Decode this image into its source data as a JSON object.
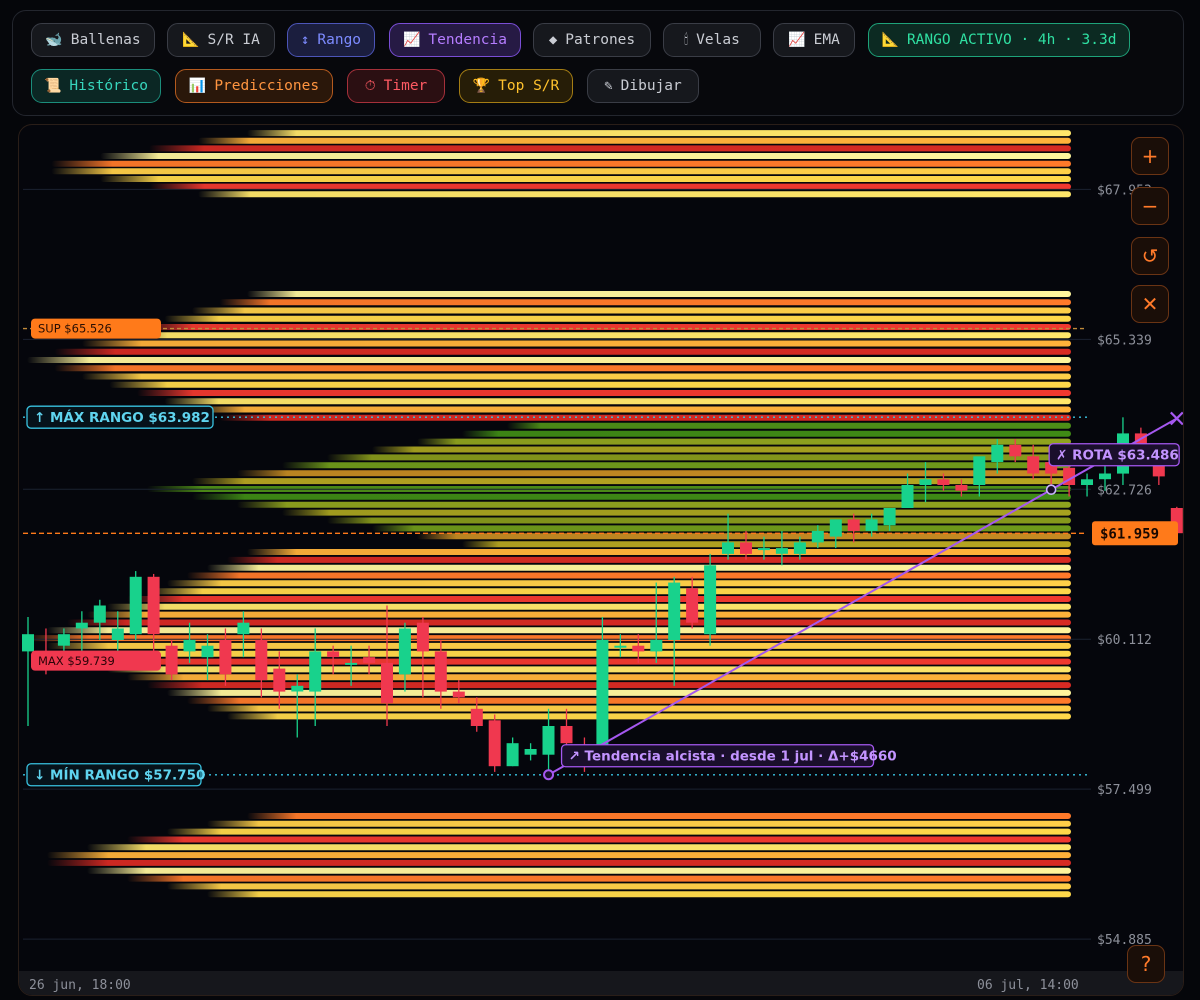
{
  "toolbar": {
    "row1": [
      {
        "name": "ballenas-button",
        "icon_name": "whale-icon",
        "icon": "🐋",
        "label": "Ballenas",
        "style": ""
      },
      {
        "name": "sr-ia-button",
        "icon_name": "triangle-ruler-icon",
        "icon": "📐",
        "label": "S/R IA",
        "style": ""
      },
      {
        "name": "rango-button",
        "icon_name": "up-down-arrow-icon",
        "icon": "↕",
        "label": "Rango",
        "style": "blue"
      },
      {
        "name": "tendencia-button",
        "icon_name": "trend-chart-icon",
        "icon": "📈",
        "label": "Tendencia",
        "style": "purple"
      },
      {
        "name": "patrones-button",
        "icon_name": "diamond-icon",
        "icon": "◆",
        "label": "Patrones",
        "style": ""
      },
      {
        "name": "velas-button",
        "icon_name": "candle-icon",
        "icon": "🕯",
        "label": "Velas",
        "style": ""
      },
      {
        "name": "ema-button",
        "icon_name": "trend-chart-icon",
        "icon": "📈",
        "label": "EMA",
        "style": ""
      },
      {
        "name": "rango-activo-button",
        "icon_name": "triangle-ruler-icon",
        "icon": "📐",
        "label": "RANGO ACTIVO · 4h · 3.3d",
        "style": "green"
      }
    ],
    "row2": [
      {
        "name": "historico-button",
        "icon_name": "scroll-icon",
        "icon": "📜",
        "label": "Histórico",
        "style": "teal"
      },
      {
        "name": "predicciones-button",
        "icon_name": "bar-chart-icon",
        "icon": "📊",
        "label": "Predicciones",
        "style": "orange"
      },
      {
        "name": "timer-button",
        "icon_name": "stopwatch-icon",
        "icon": "⏱",
        "label": "Timer",
        "style": "red"
      },
      {
        "name": "top-sr-button",
        "icon_name": "trophy-icon",
        "icon": "🏆",
        "label": "Top S/R",
        "style": "gold"
      },
      {
        "name": "dibujar-button",
        "icon_name": "pencil-icon",
        "icon": "✎",
        "label": "Dibujar",
        "style": ""
      }
    ]
  },
  "controls": [
    {
      "name": "zoom-in-button",
      "icon_name": "plus-icon",
      "glyph": "+"
    },
    {
      "name": "zoom-out-button",
      "icon_name": "minus-icon",
      "glyph": "−"
    },
    {
      "name": "reset-button",
      "icon_name": "refresh-icon",
      "glyph": "↺"
    },
    {
      "name": "close-button",
      "icon_name": "close-icon",
      "glyph": "✕"
    }
  ],
  "help": {
    "glyph": "?",
    "icon_name": "question-icon"
  },
  "colors": {
    "bull": "#18d28c",
    "bear": "#f0384f",
    "range": "#39c2e0",
    "trend": "#a558f0",
    "price": "#ff7a1a",
    "support": "#ff7a1a"
  },
  "chart_data": {
    "type": "candlestick",
    "y_axis": {
      "min": 54.4,
      "max": 68.9,
      "ticks": [
        "$67.953",
        "$65.339",
        "$62.726",
        "$60.112",
        "$57.499",
        "$54.885"
      ],
      "tick_values": [
        67.953,
        65.339,
        62.726,
        60.112,
        57.499,
        54.885
      ]
    },
    "x_axis": {
      "start_label": "26 jun, 18:00",
      "end_label": "06 jul, 14:00"
    },
    "candles": [
      [
        59.9,
        60.5,
        58.6,
        60.2
      ],
      [
        59.9,
        60.3,
        59.5,
        59.6
      ],
      [
        60.0,
        60.3,
        59.7,
        60.2
      ],
      [
        60.3,
        60.6,
        59.8,
        60.4
      ],
      [
        60.4,
        60.8,
        60.1,
        60.7
      ],
      [
        60.1,
        60.6,
        59.9,
        60.3
      ],
      [
        60.2,
        61.3,
        60.1,
        61.2
      ],
      [
        61.2,
        61.25,
        59.9,
        60.2
      ],
      [
        60.0,
        60.1,
        59.4,
        59.5
      ],
      [
        59.9,
        60.4,
        59.7,
        60.1
      ],
      [
        59.8,
        60.2,
        59.4,
        60.0
      ],
      [
        60.1,
        60.3,
        59.3,
        59.5
      ],
      [
        60.2,
        60.6,
        59.8,
        60.4
      ],
      [
        60.1,
        60.3,
        59.1,
        59.4
      ],
      [
        59.6,
        59.9,
        58.9,
        59.2
      ],
      [
        59.2,
        59.5,
        58.4,
        59.3
      ],
      [
        59.2,
        60.3,
        58.6,
        59.9
      ],
      [
        59.9,
        60.0,
        59.5,
        59.8
      ],
      [
        59.7,
        60.0,
        59.3,
        59.7
      ],
      [
        59.8,
        60.0,
        59.5,
        59.7
      ],
      [
        59.7,
        60.7,
        58.6,
        59.0
      ],
      [
        59.5,
        60.4,
        59.2,
        60.3
      ],
      [
        60.4,
        60.5,
        59.1,
        59.9
      ],
      [
        59.9,
        60.1,
        58.9,
        59.2
      ],
      [
        59.2,
        59.4,
        59.0,
        59.1
      ],
      [
        58.9,
        59.1,
        58.5,
        58.6
      ],
      [
        58.7,
        58.8,
        57.8,
        57.9
      ],
      [
        57.9,
        58.4,
        57.9,
        58.3
      ],
      [
        58.1,
        58.3,
        58.0,
        58.2
      ],
      [
        58.1,
        58.9,
        57.75,
        58.6
      ],
      [
        58.6,
        58.9,
        58.2,
        58.3
      ],
      [
        58.2,
        58.4,
        57.8,
        58.0
      ],
      [
        58.0,
        60.5,
        57.9,
        60.1
      ],
      [
        60.0,
        60.2,
        59.8,
        60.0
      ],
      [
        60.0,
        60.2,
        59.7,
        59.9
      ],
      [
        59.9,
        61.1,
        59.7,
        60.1
      ],
      [
        60.1,
        61.2,
        59.3,
        61.1
      ],
      [
        61.0,
        61.2,
        60.3,
        60.4
      ],
      [
        60.2,
        61.6,
        60.0,
        61.4
      ],
      [
        61.6,
        62.3,
        61.5,
        61.8
      ],
      [
        61.8,
        62.0,
        61.5,
        61.6
      ],
      [
        61.7,
        61.9,
        61.5,
        61.7
      ],
      [
        61.6,
        62.0,
        61.4,
        61.7
      ],
      [
        61.6,
        61.9,
        61.5,
        61.8
      ],
      [
        61.8,
        62.1,
        61.7,
        62.0
      ],
      [
        61.9,
        62.2,
        61.7,
        62.2
      ],
      [
        62.2,
        62.3,
        61.8,
        62.0
      ],
      [
        62.0,
        62.3,
        61.9,
        62.2
      ],
      [
        62.1,
        62.4,
        62.0,
        62.4
      ],
      [
        62.4,
        63.0,
        62.4,
        62.8
      ],
      [
        62.8,
        63.2,
        62.5,
        62.9
      ],
      [
        62.9,
        63.0,
        62.7,
        62.8
      ],
      [
        62.8,
        62.9,
        62.6,
        62.7
      ],
      [
        62.8,
        63.2,
        62.6,
        63.3
      ],
      [
        63.2,
        63.6,
        63.0,
        63.5
      ],
      [
        63.5,
        63.6,
        63.2,
        63.3
      ],
      [
        63.3,
        63.5,
        62.9,
        63.0
      ],
      [
        63.2,
        63.3,
        62.8,
        63.0
      ],
      [
        63.1,
        63.4,
        62.6,
        62.8
      ],
      [
        62.8,
        63.0,
        62.6,
        62.9
      ],
      [
        62.9,
        63.2,
        62.7,
        63.0
      ],
      [
        63.0,
        63.98,
        62.8,
        63.7
      ],
      [
        63.7,
        63.8,
        63.3,
        63.4
      ],
      [
        63.4,
        63.5,
        62.8,
        62.95
      ],
      [
        62.4,
        62.42,
        61.9,
        61.96
      ]
    ],
    "heat_bands": [
      {
        "from": 67.8,
        "to": 69.0,
        "intensity": "hot"
      },
      {
        "from": 63.9,
        "to": 66.2,
        "intensity": "hot"
      },
      {
        "from": 61.7,
        "to": 63.9,
        "intensity": "warm"
      },
      {
        "from": 58.7,
        "to": 61.7,
        "intensity": "hot"
      },
      {
        "from": 55.6,
        "to": 57.1,
        "intensity": "hot"
      }
    ],
    "range_max": {
      "value": 63.982,
      "label": "↑ MÁX RANGO $63.982"
    },
    "range_min": {
      "value": 57.75,
      "label": "↓ MÍN RANGO $57.750"
    },
    "support": {
      "value": 65.526,
      "label": "SUP $65.526"
    },
    "resistance_box": {
      "value": 59.739,
      "label": "MAX $59.739"
    },
    "current_price": {
      "value": 61.959,
      "label": "$61.959"
    },
    "trendline": {
      "from_candle": 29,
      "from_value": 57.75,
      "to_candle": 64,
      "to_value": 63.96,
      "label": "↗ Tendencia alcista · desde 1 jul · Δ+$4660",
      "break_label": "✗ ROTA $63.486",
      "break_candle": 57,
      "break_value": 62.9
    }
  }
}
